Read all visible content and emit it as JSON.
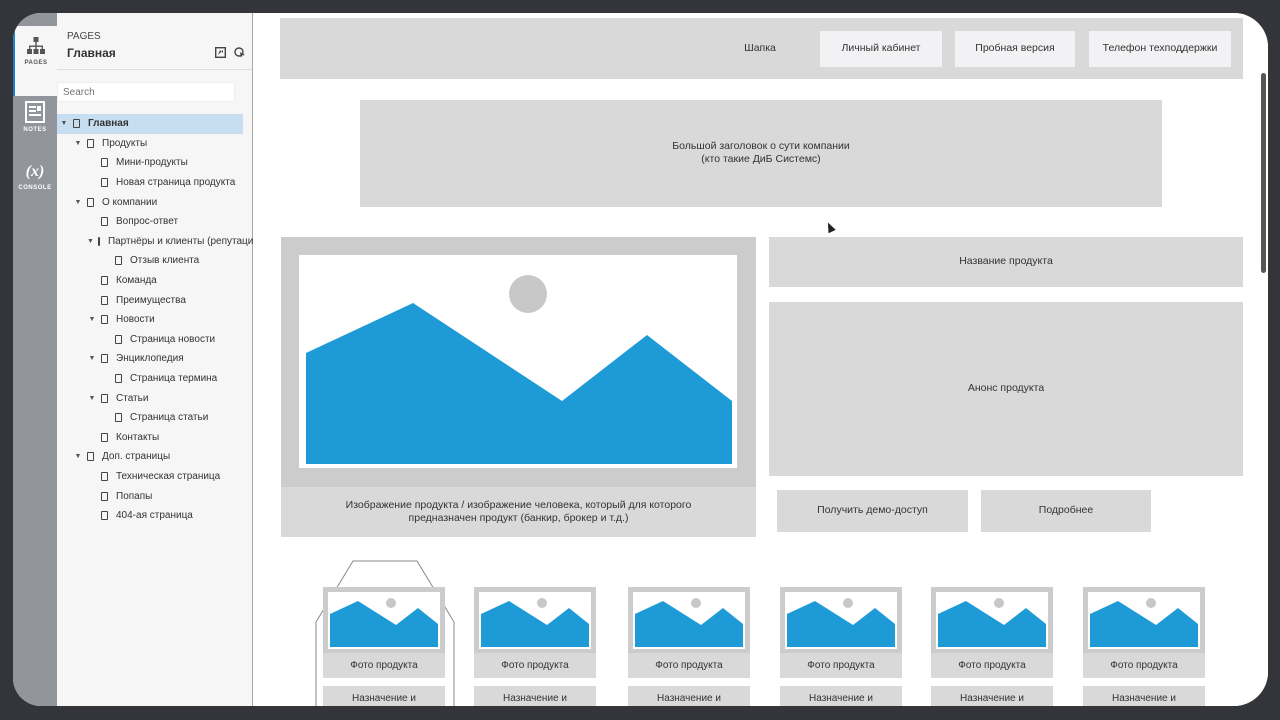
{
  "rail": {
    "tabs": [
      {
        "label": "PAGES",
        "icon": "sitemap-icon"
      },
      {
        "label": "NOTES",
        "icon": "notes-icon"
      },
      {
        "label": "CONSOLE",
        "icon": "(x)"
      }
    ]
  },
  "panel": {
    "kicker": "PAGES",
    "title": "Главная",
    "search_placeholder": "Search",
    "tree": [
      {
        "label": "Главная",
        "level": 0,
        "caret": true,
        "selected": true
      },
      {
        "label": "Продукты",
        "level": 1,
        "caret": true
      },
      {
        "label": "Мини-продукты",
        "level": 2,
        "caret": false
      },
      {
        "label": "Новая страница продукта",
        "level": 2,
        "caret": false
      },
      {
        "label": "О компании",
        "level": 1,
        "caret": true
      },
      {
        "label": "Вопрос-ответ",
        "level": 2,
        "caret": false
      },
      {
        "label": "Партнёры и клиенты (репутация)",
        "level": 2,
        "caret": true
      },
      {
        "label": "Отзыв клиента",
        "level": 3,
        "caret": false
      },
      {
        "label": "Команда",
        "level": 2,
        "caret": false
      },
      {
        "label": "Преимущества",
        "level": 2,
        "caret": false
      },
      {
        "label": "Новости",
        "level": 2,
        "caret": true
      },
      {
        "label": "Страница новости",
        "level": 3,
        "caret": false
      },
      {
        "label": "Энциклопедия",
        "level": 2,
        "caret": true
      },
      {
        "label": "Страница термина",
        "level": 3,
        "caret": false
      },
      {
        "label": "Статьи",
        "level": 2,
        "caret": true
      },
      {
        "label": "Страница статьи",
        "level": 3,
        "caret": false
      },
      {
        "label": "Контакты",
        "level": 2,
        "caret": false
      },
      {
        "label": "Доп. страницы",
        "level": 1,
        "caret": true
      },
      {
        "label": "Техническая страница",
        "level": 2,
        "caret": false
      },
      {
        "label": "Попапы",
        "level": 2,
        "caret": false
      },
      {
        "label": "404-ая страница",
        "level": 2,
        "caret": false
      }
    ]
  },
  "wireframe": {
    "header": {
      "label": "Шапка",
      "buttons": [
        "Личный кабинет",
        "Пробная версия",
        "Телефон техподдержки"
      ]
    },
    "hero": {
      "line1": "Большой заголовок о сути компании",
      "line2": "(кто такие ДиБ Системс)"
    },
    "product_image_caption_1": "Изображение продукта / изображение человека, который для которого",
    "product_image_caption_2": "предназначен продукт (банкир, брокер и т.д.)",
    "product_name": "Название продукта",
    "product_announce": "Анонс продукта",
    "demo_button": "Получить демо-доступ",
    "more_button": "Подробнее",
    "cards": [
      {
        "photo": "Фото продукта",
        "purpose": "Назначение и"
      },
      {
        "photo": "Фото продукта",
        "purpose": "Назначение и"
      },
      {
        "photo": "Фото продукта",
        "purpose": "Назначение и"
      },
      {
        "photo": "Фото продукта",
        "purpose": "Назначение и"
      },
      {
        "photo": "Фото продукта",
        "purpose": "Назначение и"
      },
      {
        "photo": "Фото продукта",
        "purpose": "Назначение и"
      }
    ],
    "colors": {
      "placeholder_blue": "#1e9bd7",
      "box_gray": "#d9d9d9",
      "selection": "#c7ddf0"
    }
  }
}
